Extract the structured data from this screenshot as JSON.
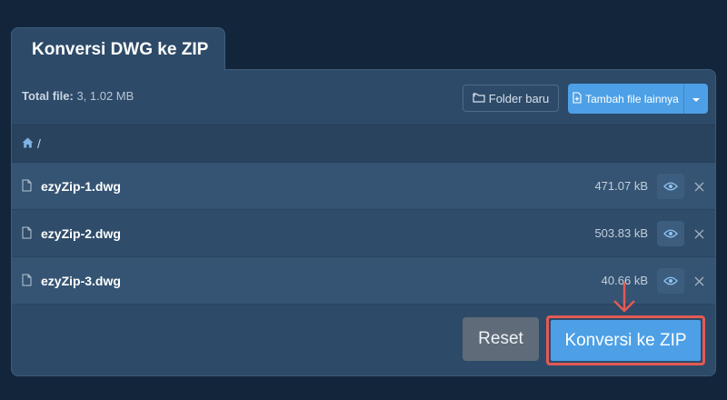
{
  "tab": {
    "title": "Konversi DWG ke ZIP"
  },
  "toolbar": {
    "total_label": "Total file:",
    "total_value": "3, 1.02 MB",
    "folder_button": "Folder baru",
    "add_button": "Tambah file lainnya"
  },
  "breadcrumb": {
    "path": "/"
  },
  "files": [
    {
      "name": "ezyZip-1.dwg",
      "size": "471.07 kB"
    },
    {
      "name": "ezyZip-2.dwg",
      "size": "503.83 kB"
    },
    {
      "name": "ezyZip-3.dwg",
      "size": "40.66 kB"
    }
  ],
  "footer": {
    "reset_button": "Reset",
    "convert_button": "Konversi ke ZIP"
  },
  "colors": {
    "background": "#12253a",
    "panel": "#2d4a68",
    "accent": "#4da0e6",
    "highlight": "#e25a55"
  },
  "icons": [
    "folder-plus-icon",
    "file-plus-icon",
    "caret-down-icon",
    "home-icon",
    "file-icon",
    "eye-icon",
    "close-icon",
    "arrow-down-icon"
  ]
}
